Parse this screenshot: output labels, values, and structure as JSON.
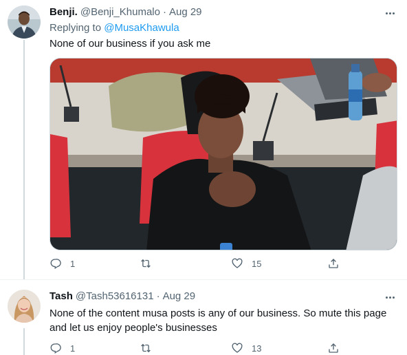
{
  "tweets": [
    {
      "display_name": "Benji.",
      "handle": "@Benji_Khumalo",
      "separator": "·",
      "date": "Aug 29",
      "replying_prefix": "Replying to",
      "replying_to": "@MusaKhawula",
      "text": "None of our business if you ask me",
      "avatar_icon": "avatar-photo",
      "media_icon": "attached-photo",
      "replies": "1",
      "retweets": "",
      "likes": "15"
    },
    {
      "display_name": "Tash",
      "handle": "@Tash53616131",
      "separator": "·",
      "date": "Aug 29",
      "text": "None of the content  musa posts is any of our business. So mute this page and let us enjoy people's businesses",
      "avatar_icon": "avatar-photo",
      "replies": "1",
      "retweets": "",
      "likes": "13"
    }
  ],
  "colors": {
    "accent": "#1d9bf0",
    "secondary_text": "#536471",
    "primary_text": "#0f1419",
    "thread_line": "#cfd9de"
  }
}
